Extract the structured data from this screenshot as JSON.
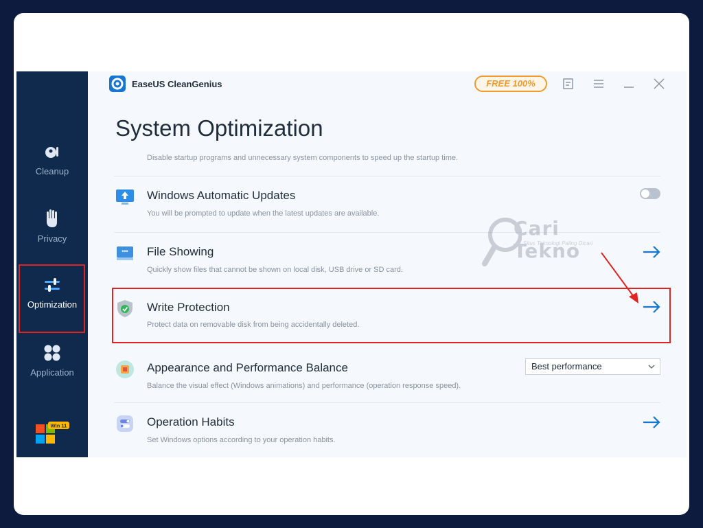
{
  "app": {
    "name": "EaseUS CleanGenius",
    "badge": "FREE 100%"
  },
  "sidebar": {
    "items": [
      {
        "label": "Cleanup",
        "icon": "broom-icon"
      },
      {
        "label": "Privacy",
        "icon": "hand-icon"
      },
      {
        "label": "Optimization",
        "icon": "sliders-icon",
        "active": true
      },
      {
        "label": "Application",
        "icon": "apps-icon"
      }
    ],
    "win_badge": "Win 11"
  },
  "page": {
    "title": "System Optimization",
    "top_description": "Disable startup programs and unnecessary system components to speed up the startup time."
  },
  "options": [
    {
      "title": "Windows Automatic Updates",
      "description": "You will be prompted to update when the latest updates are available.",
      "control": "toggle",
      "on": false,
      "icon": "monitor-update-icon"
    },
    {
      "title": "File Showing",
      "description": "Quickly show files that cannot be shown on local disk, USB drive or SD card.",
      "control": "arrow",
      "icon": "file-show-icon"
    },
    {
      "title": "Write Protection",
      "description": "Protect data on removable disk from being accidentally deleted.",
      "control": "arrow",
      "icon": "shield-icon"
    },
    {
      "title": "Appearance and Performance Balance",
      "description": "Balance the visual effect (Windows animations) and performance (operation response speed).",
      "control": "select",
      "selected": "Best performance",
      "icon": "chip-icon"
    },
    {
      "title": "Operation Habits",
      "description": "Set Windows options according to your operation habits.",
      "control": "arrow",
      "icon": "toggle-habits-icon"
    }
  ],
  "watermark": {
    "text": "Cari Tekno",
    "tagline": "Situs Teknologi Paling Dicari"
  },
  "colors": {
    "sidebar": "#0f2a4d",
    "accent": "#1677d2",
    "badge": "#f29a2e",
    "annotation": "#e02424"
  }
}
